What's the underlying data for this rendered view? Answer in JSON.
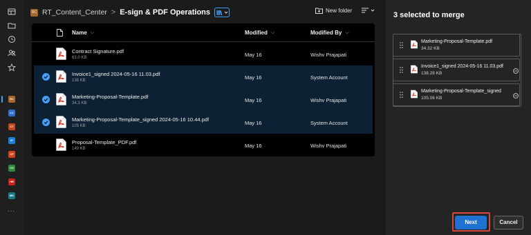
{
  "rail": {
    "sites": [
      {
        "abbr": "RC",
        "color": "#a5662b"
      },
      {
        "abbr": "LC",
        "color": "#2f6fc7"
      },
      {
        "abbr": "CT",
        "color": "#c4461d"
      },
      {
        "abbr": "IP",
        "color": "#1f7fd6"
      },
      {
        "abbr": "CF",
        "color": "#d0451b"
      },
      {
        "abbr": "CS",
        "color": "#2f8a3e"
      },
      {
        "abbr": "HR",
        "color": "#c4211f"
      },
      {
        "abbr": "MK",
        "color": "#1b7a8c"
      }
    ],
    "more": "..."
  },
  "breadcrumb": {
    "site_badge": "RC",
    "root": "RT_Content_Center",
    "separator": ">",
    "library": "E-sign & PDF Operations"
  },
  "toolbar": {
    "new_folder": "New folder"
  },
  "list": {
    "columns": {
      "name": "Name",
      "modified": "Modified",
      "modified_by": "Modified By"
    },
    "rows": [
      {
        "name": "Contract Signature.pdf",
        "size": "63.0 KB",
        "modified": "May 16",
        "modified_by": "Wishv Prajapati",
        "selected": false
      },
      {
        "name": "Invoice1_signed 2024-05-16 11.03.pdf",
        "size": "138 KB",
        "modified": "May 16",
        "modified_by": "System Account",
        "selected": true
      },
      {
        "name": "Marketing-Proposal-Template.pdf",
        "size": "34.3 KB",
        "modified": "May 16",
        "modified_by": "Wishv Prajapati",
        "selected": true
      },
      {
        "name": "Marketing-Proposal-Template_signed 2024-05-16 10.44.pdf",
        "size": "105 KB",
        "modified": "May 16",
        "modified_by": "System Account",
        "selected": true
      },
      {
        "name": "Proposal-Template_PDF.pdf",
        "size": "149 KB",
        "modified": "May 16",
        "modified_by": "Wishv Prajapati",
        "selected": false
      }
    ]
  },
  "merge_panel": {
    "title": "3 selected to merge",
    "items": [
      {
        "name": "Marketing-Proposal-Template.pdf",
        "size": "34.32 KB"
      },
      {
        "name": "Invoice1_signed 2024-05-16 11.03.pdf",
        "size": "138.28 KB"
      },
      {
        "name": "Marketing-Proposal-Template_signed",
        "size": "105.06 KB"
      }
    ],
    "next_label": "Next",
    "cancel_label": "Cancel"
  },
  "colors": {
    "accent": "#479ef5",
    "primary_button": "#1f72d1",
    "highlight": "#d9463d",
    "pdf_red": "#d83b2b",
    "selected_row": "#0c2133"
  }
}
